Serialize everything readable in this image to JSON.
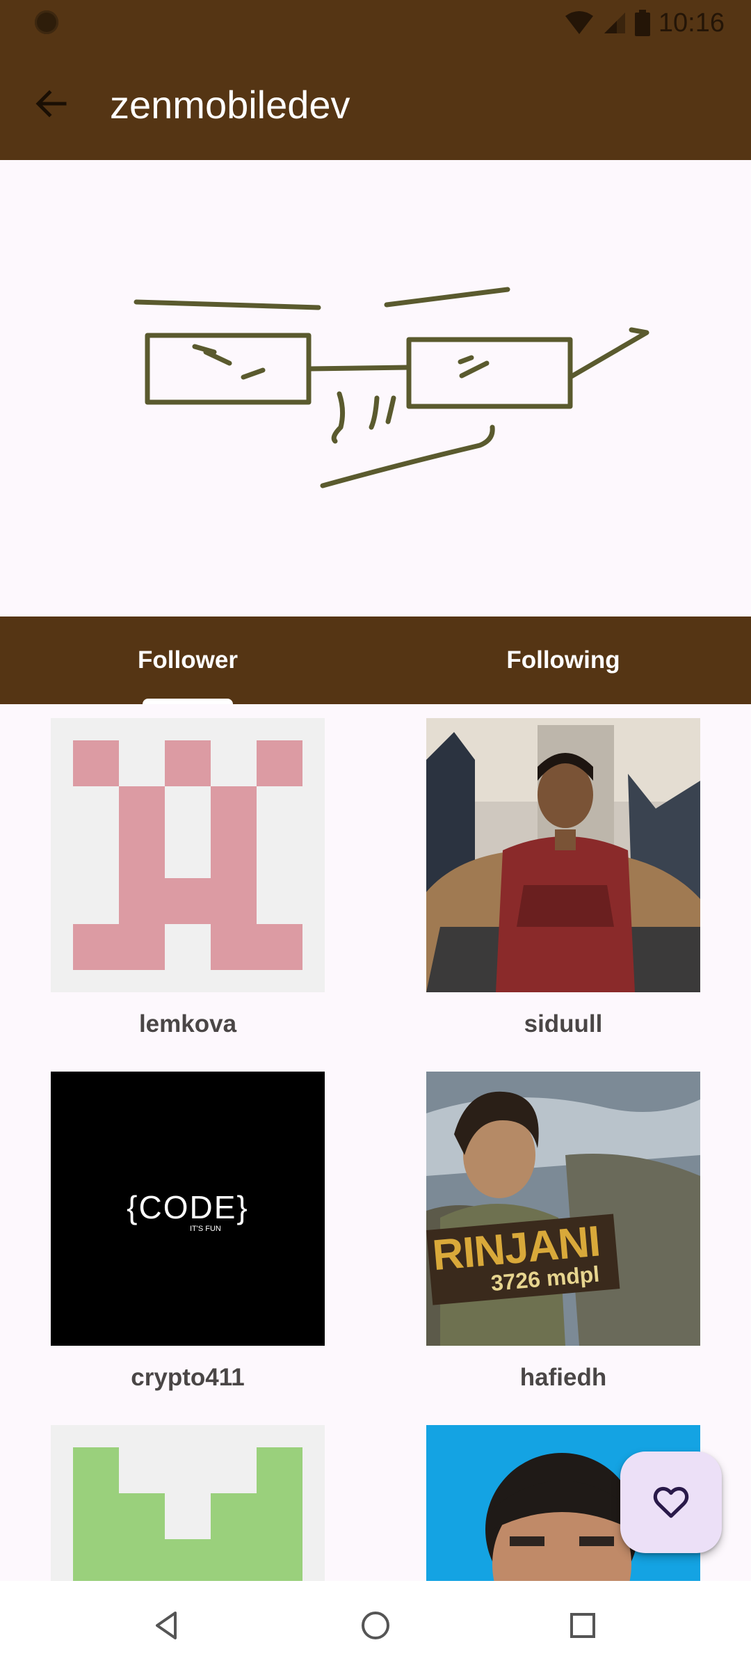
{
  "status_bar": {
    "time": "10:16",
    "icons": [
      "wifi-icon",
      "signal-icon",
      "battery-icon"
    ]
  },
  "toolbar": {
    "title": "zenmobiledev",
    "back_icon": "arrow-left-icon"
  },
  "tabs": [
    {
      "label": "Follower",
      "selected": true
    },
    {
      "label": "Following",
      "selected": false
    }
  ],
  "users": [
    {
      "name": "lemkova"
    },
    {
      "name": "siduull"
    },
    {
      "name": "crypto411"
    },
    {
      "name": "hafiedh"
    },
    {
      "name": ""
    },
    {
      "name": ""
    }
  ],
  "code_avatar": {
    "main": "{CODE}",
    "sub": "IT'S FUN"
  },
  "rinjani_sign": {
    "line1": "RINJANI",
    "line2": "3726 mdpl"
  },
  "fab": {
    "icon": "heart-outline-icon"
  },
  "nav": [
    "back-triangle-icon",
    "home-circle-icon",
    "recents-square-icon"
  ],
  "colors": {
    "primary": "#553514",
    "background": "#fdf8fd",
    "fab": "#ece0f7",
    "identicon_pink": "#dc9ba3",
    "identicon_green": "#9ad07c"
  }
}
